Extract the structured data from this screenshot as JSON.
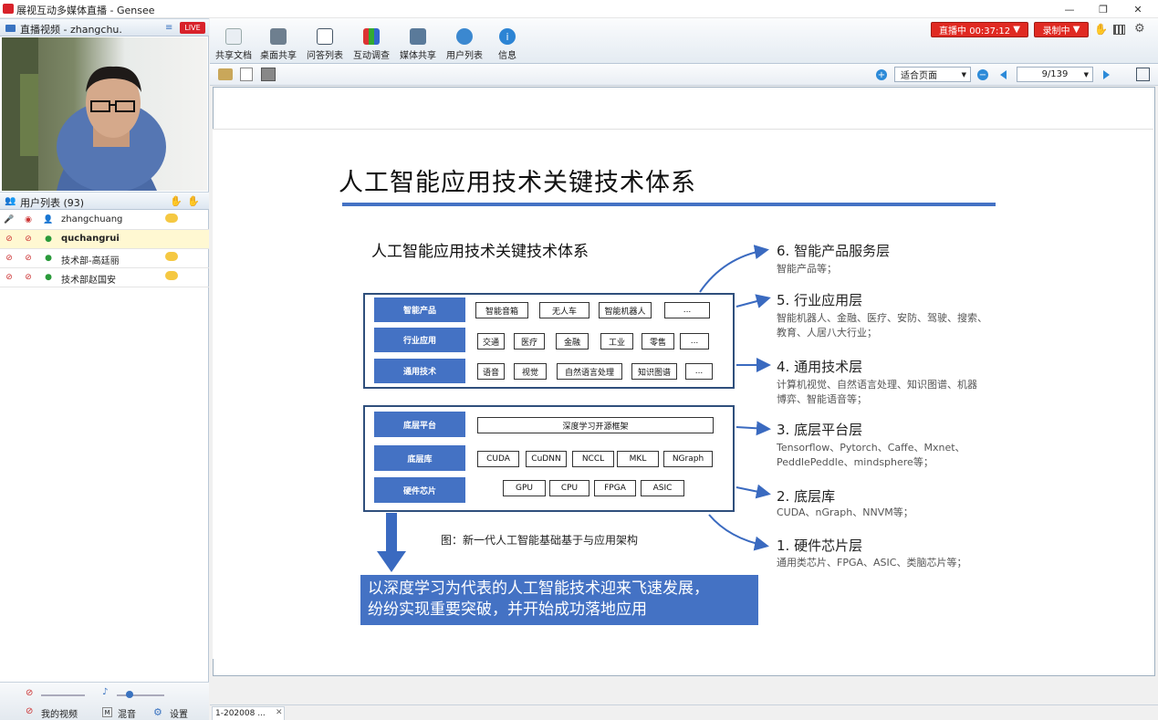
{
  "window": {
    "title": "展视互动多媒体直播 - Gensee",
    "min": "—",
    "restore": "❐",
    "close": "✕"
  },
  "video_panel": {
    "title": "直播视频 - zhangchu.",
    "live": "LIVE"
  },
  "user_panel": {
    "title": "用户列表 (93)"
  },
  "users": [
    {
      "name": "zhangchuang"
    },
    {
      "name": "quchangrui"
    },
    {
      "name": "技术部-高廷丽"
    },
    {
      "name": "技术部赵国安"
    }
  ],
  "toolbar": {
    "items": [
      {
        "label": "共享文档",
        "icon": "document-icon"
      },
      {
        "label": "桌面共享",
        "icon": "desktop-share-icon"
      },
      {
        "label": "问答列表",
        "icon": "qa-list-icon"
      },
      {
        "label": "互动调查",
        "icon": "survey-chart-icon"
      },
      {
        "label": "媒体共享",
        "icon": "media-share-icon"
      },
      {
        "label": "用户列表",
        "icon": "users-icon"
      },
      {
        "label": "信息",
        "icon": "info-icon"
      }
    ]
  },
  "live_status": "直播中 00:37:12",
  "record_status": "录制中",
  "zoom": {
    "value": "适合页面"
  },
  "page": {
    "value": "9/139"
  },
  "nav": {
    "prev": "❮",
    "next": "❯"
  },
  "bottom_tab": "1-202008 ...",
  "bottom_controls": {
    "my_video": "我的视频",
    "mix": "混音",
    "settings": "设置"
  },
  "slide": {
    "title": "人工智能应用技术关键技术体系",
    "subtitle": "人工智能应用技术关键技术体系",
    "caption": "图：新一代人工智能基础基于与应用架构",
    "banner": "以深度学习为代表的人工智能技术迎来飞速发展，\n纷纷实现重要突破，并开始成功落地应用",
    "top_rows": [
      {
        "label": "智能产品",
        "chips": [
          "智能音箱",
          "无人车",
          "智能机器人",
          "..."
        ]
      },
      {
        "label": "行业应用",
        "chips": [
          "交通",
          "医疗",
          "金融",
          "工业",
          "零售",
          "..."
        ]
      },
      {
        "label": "通用技术",
        "chips": [
          "语音",
          "视觉",
          "自然语言处理",
          "知识图谱",
          "..."
        ]
      }
    ],
    "bottom_rows": [
      {
        "label": "底层平台",
        "chips": [
          "深度学习开源框架"
        ]
      },
      {
        "label": "底层库",
        "chips": [
          "CUDA",
          "CuDNN",
          "NCCL",
          "MKL",
          "NGraph"
        ]
      },
      {
        "label": "硬件芯片",
        "chips": [
          "GPU",
          "CPU",
          "FPGA",
          "ASIC"
        ]
      }
    ],
    "layers": [
      {
        "title": "6. 智能产品服务层",
        "desc": "智能产品等；"
      },
      {
        "title": "5. 行业应用层",
        "desc": "智能机器人、金融、医疗、安防、驾驶、搜索、\n教育、人居八大行业；"
      },
      {
        "title": "4. 通用技术层",
        "desc": "计算机视觉、自然语言处理、知识图谱、机器\n博弈、智能语音等；"
      },
      {
        "title": "3. 底层平台层",
        "desc": "Tensorflow、Pytorch、Caffe、Mxnet、\nPeddlePeddle、mindsphere等；"
      },
      {
        "title": "2. 底层库",
        "desc": "CUDA、nGraph、NNVM等；"
      },
      {
        "title": "1. 硬件芯片层",
        "desc": "通用类芯片、FPGA、ASIC、类脑芯片等；"
      }
    ]
  }
}
